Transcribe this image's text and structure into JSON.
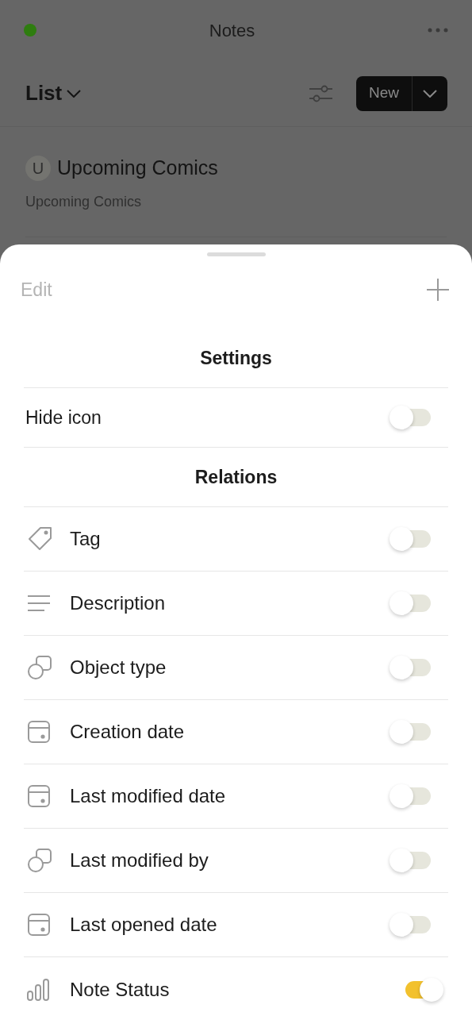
{
  "header": {
    "title": "Notes"
  },
  "toolbar": {
    "view": "List",
    "new_button": "New"
  },
  "objects": [
    {
      "initial": "U",
      "title": "Upcoming Comics",
      "subtitle": "Upcoming Comics"
    }
  ],
  "sheet": {
    "edit": "Edit",
    "settings_title": "Settings",
    "settings": [
      {
        "label": "Hide icon",
        "on": false
      }
    ],
    "relations_title": "Relations",
    "relations": [
      {
        "kind": "tag",
        "label": "Tag",
        "on": false
      },
      {
        "kind": "text",
        "label": "Description",
        "on": false
      },
      {
        "kind": "type",
        "label": "Object type",
        "on": false
      },
      {
        "kind": "date",
        "label": "Creation date",
        "on": false
      },
      {
        "kind": "date",
        "label": "Last modified date",
        "on": false
      },
      {
        "kind": "type",
        "label": "Last modified by",
        "on": false
      },
      {
        "kind": "date",
        "label": "Last opened date",
        "on": false
      },
      {
        "kind": "status",
        "label": "Note Status",
        "on": true
      }
    ]
  }
}
